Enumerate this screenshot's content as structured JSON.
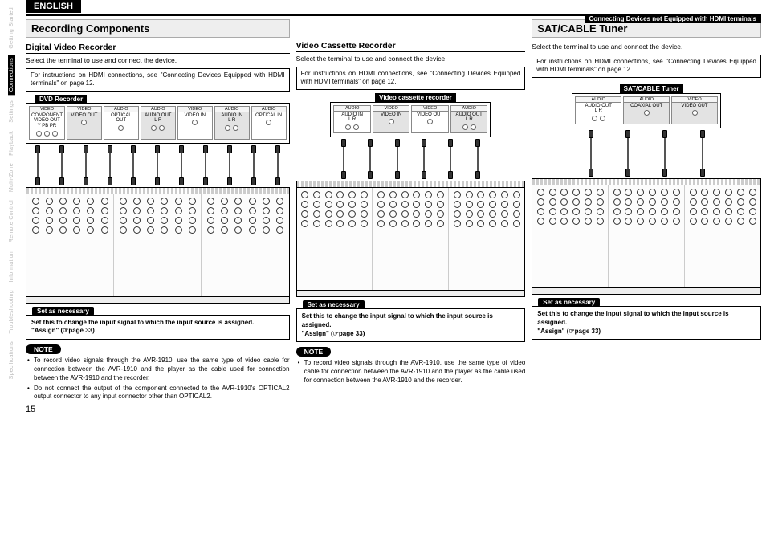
{
  "language": "ENGLISH",
  "header_chip": "Connecting Devices not Equipped with HDMI terminals",
  "page_number": "15",
  "sidebar": {
    "tabs": [
      {
        "label": "Getting Started",
        "active": false
      },
      {
        "label": "Connections",
        "active": true
      },
      {
        "label": "Settings",
        "active": false
      },
      {
        "label": "Playback",
        "active": false
      },
      {
        "label": "Multi-Zone",
        "active": false
      },
      {
        "label": "Remote Control",
        "active": false
      },
      {
        "label": "Information",
        "active": false
      },
      {
        "label": "Troubleshooting",
        "active": false
      },
      {
        "label": "Specifications",
        "active": false
      }
    ]
  },
  "sections": {
    "recording": {
      "title": "Recording Components"
    },
    "satcable": {
      "title": "SAT/CABLE Tuner"
    }
  },
  "common": {
    "select_terminal": "Select the terminal to use and connect the device.",
    "hdmi_hint": "For instructions on HDMI connections, see \"Connecting Devices Equipped with HDMI terminals\" on page 12.",
    "set_as_necessary": "Set as necessary",
    "set_box_text": "Set this to change the input signal to which the input source is assigned.",
    "assign_ref": "\"Assign\" (☞page 33)",
    "note_label": "NOTE"
  },
  "dvr": {
    "subtitle": "Digital Video Recorder",
    "device_label": "DVD Recorder",
    "groups": [
      {
        "cat": "VIDEO",
        "name": "COMPONENT VIDEO OUT",
        "sub": "Y  PB  PR",
        "jacks": 3,
        "shaded": false
      },
      {
        "cat": "VIDEO",
        "name": "VIDEO OUT",
        "sub": "",
        "jacks": 1,
        "shaded": true
      },
      {
        "cat": "AUDIO",
        "name": "OPTICAL OUT",
        "sub": "",
        "jacks": 1,
        "shaded": false
      },
      {
        "cat": "AUDIO",
        "name": "AUDIO OUT",
        "sub": "L   R",
        "jacks": 2,
        "shaded": true
      },
      {
        "cat": "VIDEO",
        "name": "VIDEO IN",
        "sub": "",
        "jacks": 1,
        "shaded": false
      },
      {
        "cat": "AUDIO",
        "name": "AUDIO IN",
        "sub": "L   R",
        "jacks": 2,
        "shaded": true
      },
      {
        "cat": "AUDIO",
        "name": "OPTICAL IN",
        "sub": "",
        "jacks": 1,
        "shaded": false
      }
    ],
    "notes": [
      "To record video signals through the AVR-1910, use the same type of video cable for connection between the AVR-1910 and the player as the cable used for connection between the AVR-1910 and the recorder.",
      "Do not connect the output of the component connected to the AVR-1910's OPTICAL2 output connector to any input connector other than OPTICAL2."
    ]
  },
  "vcr": {
    "subtitle": "Video Cassette Recorder",
    "device_label": "Video cassette recorder",
    "groups": [
      {
        "cat": "AUDIO",
        "name": "AUDIO IN",
        "sub": "L   R",
        "jacks": 2,
        "shaded": false
      },
      {
        "cat": "VIDEO",
        "name": "VIDEO IN",
        "sub": "",
        "jacks": 1,
        "shaded": true
      },
      {
        "cat": "VIDEO",
        "name": "VIDEO OUT",
        "sub": "",
        "jacks": 1,
        "shaded": false
      },
      {
        "cat": "AUDIO",
        "name": "AUDIO OUT",
        "sub": "L   R",
        "jacks": 2,
        "shaded": true
      }
    ],
    "notes": [
      "To record video signals through the AVR-1910, use the same type of video cable for connection between the AVR-1910 and the player as the cable used for connection between the AVR-1910 and the recorder."
    ]
  },
  "sat": {
    "device_label": "SAT/CABLE Tuner",
    "groups": [
      {
        "cat": "AUDIO",
        "name": "AUDIO OUT",
        "sub": "L   R",
        "jacks": 2,
        "shaded": false
      },
      {
        "cat": "AUDIO",
        "name": "COAXIAL OUT",
        "sub": "",
        "jacks": 1,
        "shaded": true
      },
      {
        "cat": "VIDEO",
        "name": "VIDEO OUT",
        "sub": "",
        "jacks": 1,
        "shaded": true
      }
    ]
  }
}
